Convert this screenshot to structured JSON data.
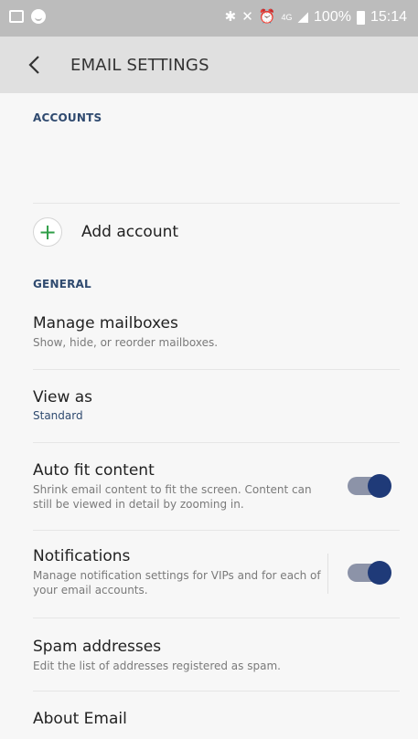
{
  "status_bar": {
    "network": "4G",
    "battery": "100%",
    "time": "15:14"
  },
  "header": {
    "title": "EMAIL SETTINGS"
  },
  "accounts": {
    "heading": "ACCOUNTS",
    "add_account_label": "Add account"
  },
  "general": {
    "heading": "GENERAL",
    "items": [
      {
        "title": "Manage mailboxes",
        "subtitle": "Show, hide, or reorder mailboxes."
      },
      {
        "title": "View as",
        "value": "Standard"
      },
      {
        "title": "Auto fit content",
        "subtitle": "Shrink email content to fit the screen. Content can still be viewed in detail by zooming in.",
        "enabled": true
      },
      {
        "title": "Notifications",
        "subtitle": "Manage notification settings for VIPs and for each of your email accounts.",
        "enabled": true
      },
      {
        "title": "Spam addresses",
        "subtitle": "Edit the list of addresses registered as spam."
      },
      {
        "title": "About Email"
      }
    ]
  }
}
